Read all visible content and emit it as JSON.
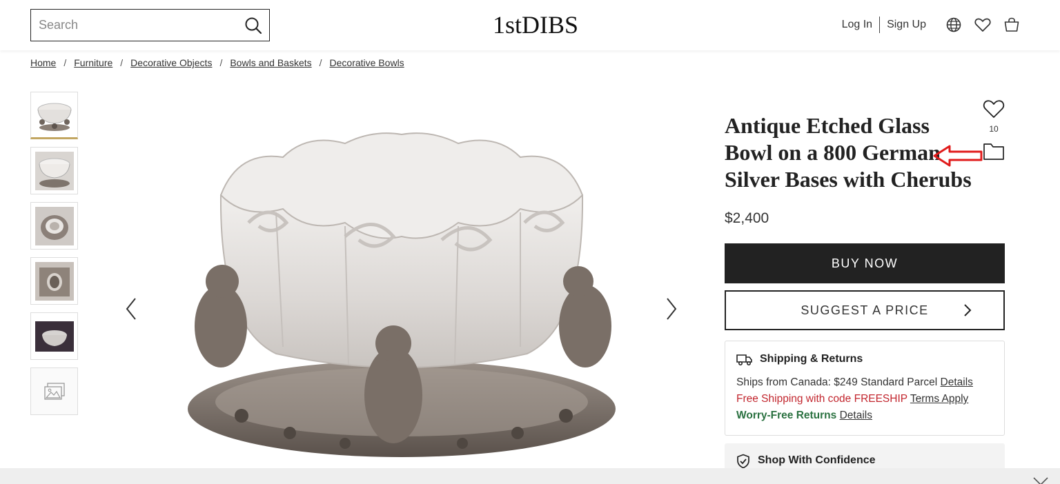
{
  "header": {
    "search_placeholder": "Search",
    "logo_text": "1stDIBS",
    "login": "Log In",
    "signup": "Sign Up"
  },
  "breadcrumb": [
    "Home",
    "Furniture",
    "Decorative Objects",
    "Bowls and Baskets",
    "Decorative Bowls"
  ],
  "product": {
    "title": "Antique Etched Glass Bowl on a 800 German Silver Bases with Cherubs",
    "favorites_count": "10",
    "price": "$2,400",
    "buy_label": "BUY NOW",
    "suggest_label": "SUGGEST A PRICE"
  },
  "shipping": {
    "heading": "Shipping & Returns",
    "line1_text": "Ships from Canada: $249 Standard Parcel",
    "line1_link": "Details",
    "line2_text": "Free Shipping with code FREESHIP",
    "line2_link": "Terms Apply",
    "line3_text": "Worry-Free Returns",
    "line3_link": "Details"
  },
  "confidence": {
    "heading": "Shop With Confidence"
  },
  "colors": {
    "accent_gold": "#c2a661",
    "promo_red": "#c2262e",
    "returns_green": "#2a7140",
    "button_dark": "#222222",
    "annotation_arrow": "#e01b1b"
  }
}
